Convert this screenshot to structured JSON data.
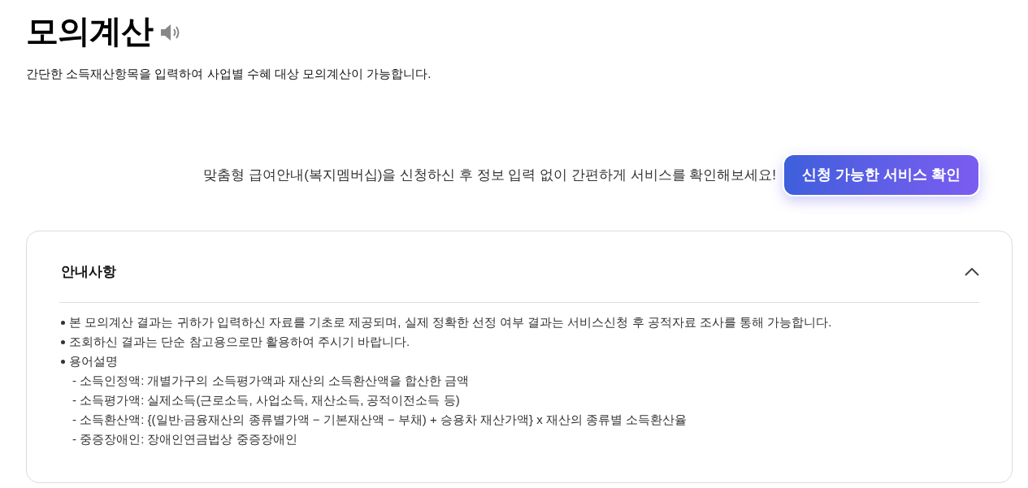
{
  "page": {
    "title": "모의계산",
    "subtitle": "간단한 소득재산항목을 입력하여 사업별 수혜 대상 모의계산이 가능합니다."
  },
  "promo": {
    "text": "맞춤형 급여안내(복지멤버십)을 신청하신 후 정보 입력 없이 간편하게 서비스를 확인해보세요!",
    "button": "신청 가능한 서비스 확인"
  },
  "notice": {
    "title": "안내사항",
    "expanded": true,
    "items": [
      {
        "text": "본 모의계산 결과는 귀하가 입력하신 자료를 기초로 제공되며, 실제 정확한 선정 여부 결과는 서비스신청 후 공적자료 조사를 통해 가능합니다."
      },
      {
        "text": "조회하신 결과는 단순 참고용으로만 활용하여 주시기 바랍니다."
      },
      {
        "text": "용어설명",
        "children": [
          {
            "text": "- 소득인정액: 개별가구의 소득평가액과 재산의 소득환산액을 합산한 금액"
          },
          {
            "text": "- 소득평가액: 실제소득(근로소득, 사업소득, 재산소득, 공적이전소득 등)"
          },
          {
            "text": "- 소득환산액: {(일반·금융재산의 종류별가액 − 기본재산액 − 부채) + 승용차 재산가액} x 재산의 종류별 소득환산율"
          },
          {
            "text": "- 중증장애인: 장애인연금법상 중증장애인"
          }
        ]
      }
    ]
  }
}
